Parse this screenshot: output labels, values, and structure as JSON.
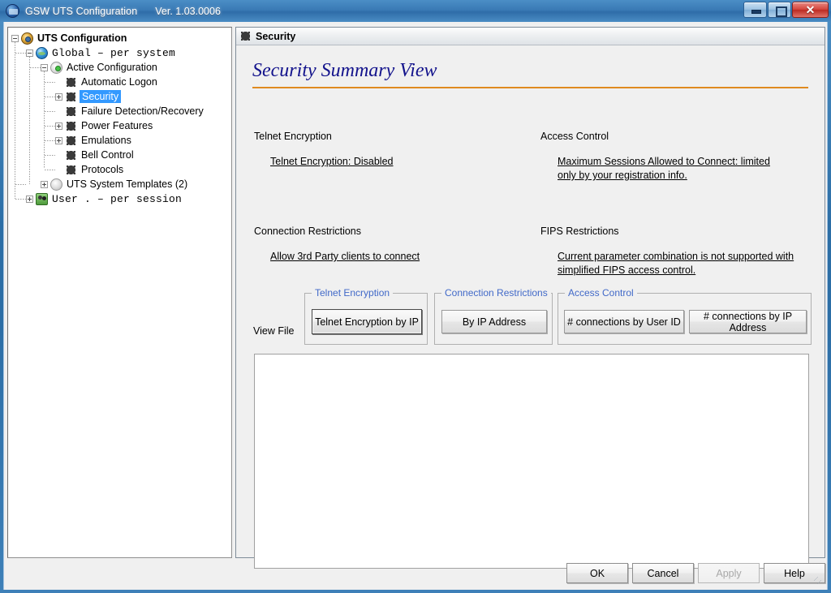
{
  "window": {
    "title": "GSW UTS Configuration",
    "version": "Ver. 1.03.0006",
    "icon": "app-globe-icon",
    "controls": {
      "minimize": "minimize",
      "maximize": "maximize",
      "close": "✕"
    }
  },
  "tree": {
    "nodes": [
      {
        "label": "UTS Configuration",
        "icon": "gear-gold-icon",
        "indent": 0,
        "expander": "minus",
        "bold": true,
        "mono": false,
        "selected": false
      },
      {
        "label": "Global  – per system",
        "icon": "globe-icon",
        "indent": 1,
        "expander": "minus",
        "bold": false,
        "mono": true,
        "selected": false
      },
      {
        "label": "Active Configuration",
        "icon": "gear-green-icon",
        "indent": 2,
        "expander": "minus",
        "bold": false,
        "mono": false,
        "selected": false
      },
      {
        "label": "Automatic Logon",
        "icon": "gear-icon",
        "indent": 3,
        "expander": "none",
        "bold": false,
        "mono": false,
        "selected": false
      },
      {
        "label": "Security",
        "icon": "gear-icon",
        "indent": 3,
        "expander": "plus",
        "bold": false,
        "mono": false,
        "selected": true
      },
      {
        "label": "Failure Detection/Recovery",
        "icon": "gear-icon",
        "indent": 3,
        "expander": "none",
        "bold": false,
        "mono": false,
        "selected": false
      },
      {
        "label": "Power Features",
        "icon": "gear-icon",
        "indent": 3,
        "expander": "plus",
        "bold": false,
        "mono": false,
        "selected": false
      },
      {
        "label": "Emulations",
        "icon": "gear-icon",
        "indent": 3,
        "expander": "plus",
        "bold": false,
        "mono": false,
        "selected": false
      },
      {
        "label": "Bell Control",
        "icon": "gear-icon",
        "indent": 3,
        "expander": "none",
        "bold": false,
        "mono": false,
        "selected": false
      },
      {
        "label": "Protocols",
        "icon": "gear-icon",
        "indent": 3,
        "expander": "none",
        "bold": false,
        "mono": false,
        "selected": false
      },
      {
        "label": "UTS System Templates (2)",
        "icon": "gear-gray-icon",
        "indent": 2,
        "expander": "plus",
        "bold": false,
        "mono": false,
        "selected": false
      },
      {
        "label": "User .   – per session",
        "icon": "users-icon",
        "indent": 1,
        "expander": "plus",
        "bold": false,
        "mono": true,
        "selected": false
      }
    ]
  },
  "panel": {
    "header_title": "Security",
    "header_icon": "gear-icon",
    "page_title": "Security Summary View",
    "accent_color": "#e08a20",
    "title_color": "#13138c",
    "sections": [
      {
        "heading": "Telnet Encryption",
        "link": "Telnet Encryption: Disabled"
      },
      {
        "heading": "Access Control",
        "link": "Maximum Sessions Allowed to Connect: limited only by your registration info."
      },
      {
        "heading": "Connection Restrictions",
        "link": "Allow 3rd Party clients to connect"
      },
      {
        "heading": "FIPS Restrictions",
        "link": "Current parameter combination is not supported with simplified FIPS access control."
      }
    ],
    "view_file_label": "View File",
    "groups": [
      {
        "label": "Telnet Encryption",
        "buttons": [
          {
            "label": "Telnet Encryption by IP",
            "focused": true
          }
        ]
      },
      {
        "label": "Connection Restrictions",
        "buttons": [
          {
            "label": "By IP Address",
            "focused": false
          }
        ]
      },
      {
        "label": "Access Control",
        "buttons": [
          {
            "label": "# connections by User ID",
            "focused": false
          },
          {
            "label": "# connections by IP Address",
            "focused": false
          }
        ]
      }
    ],
    "output_text": ""
  },
  "footer": {
    "buttons": [
      {
        "label": "OK",
        "enabled": true
      },
      {
        "label": "Cancel",
        "enabled": true
      },
      {
        "label": "Apply",
        "enabled": false
      },
      {
        "label": "Help",
        "enabled": true
      }
    ]
  }
}
